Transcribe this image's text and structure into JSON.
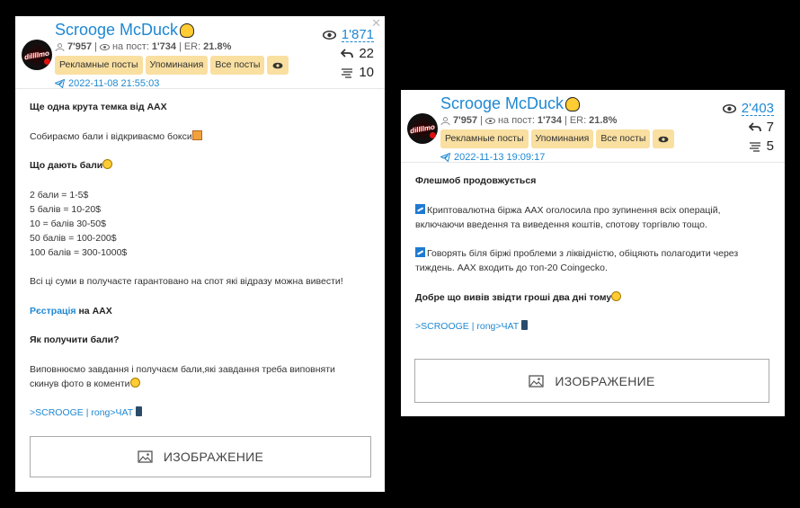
{
  "cards": [
    {
      "name": "Scrooge McDuck",
      "subscribers": "7'957",
      "per_post_label": "на пост:",
      "per_post": "1'734",
      "er_label": "ER:",
      "er": "21.8%",
      "buttons": [
        "Рекламные посты",
        "Упоминания",
        "Все посты"
      ],
      "date": "2022-11-08 21:55:03",
      "views": "1'871",
      "reposts": "22",
      "comments": "10",
      "lines": [
        {
          "t": "Ще одна крута темка від AAX",
          "s": "bold"
        },
        {
          "t": "Собираємо бали і відкриваємо бокси",
          "s": "gift"
        },
        {
          "t": "Що дають бали",
          "s": "bold-emo"
        },
        {
          "t": "2 бали = 1-5$"
        },
        {
          "t": "5 балів = 10-20$"
        },
        {
          "t": "10 = балів 30-50$"
        },
        {
          "t": "50 балів = 100-200$"
        },
        {
          "t": "100 балів = 300-1000$"
        },
        {
          "t": "Всі ці суми в получаєте гарантовано на спот які відразу можна вивести!"
        },
        {
          "t": "Рєстрація",
          "t2": " на AAX",
          "s": "reg"
        },
        {
          "t": "Як получити бали?",
          "s": "bold"
        },
        {
          "t": "Виповнюємо завдання і получаєм бали,які завдання треба виповняти скинув фото в коменти",
          "s": "emo"
        },
        {
          "t": ">SCROOGE | rong>ЧАТ",
          "s": "link-phone"
        }
      ],
      "image_label": "ИЗОБРАЖЕНИЕ"
    },
    {
      "name": "Scrooge McDuck",
      "subscribers": "7'957",
      "per_post_label": "на пост:",
      "per_post": "1'734",
      "er_label": "ER:",
      "er": "21.8%",
      "buttons": [
        "Рекламные посты",
        "Упоминания",
        "Все посты"
      ],
      "date": "2022-11-13 19:09:17",
      "views": "2'403",
      "reposts": "7",
      "comments": "5",
      "lines": [
        {
          "t": "Флешмоб продовжується",
          "s": "bold"
        },
        {
          "t": "Криптовалютна біржа AAX оголосила про зупинення всіх операцій, включаючи введення та виведення коштів, спотову торгівлю тощо.",
          "s": "sq"
        },
        {
          "t": "Говорять біля біржі проблеми з ліквідністю, обіцяють полагодити через тиждень. AAX входить до топ-20 Coingecko.",
          "s": "sq"
        },
        {
          "t": "Добре що вивів звідти гроші два дні тому",
          "s": "bold-emo"
        },
        {
          "t": ">SCROOGE | rong>ЧАТ",
          "s": "link-phone"
        }
      ],
      "image_label": "ИЗОБРАЖЕНИЕ"
    }
  ],
  "avatar_text": "dillllmo"
}
